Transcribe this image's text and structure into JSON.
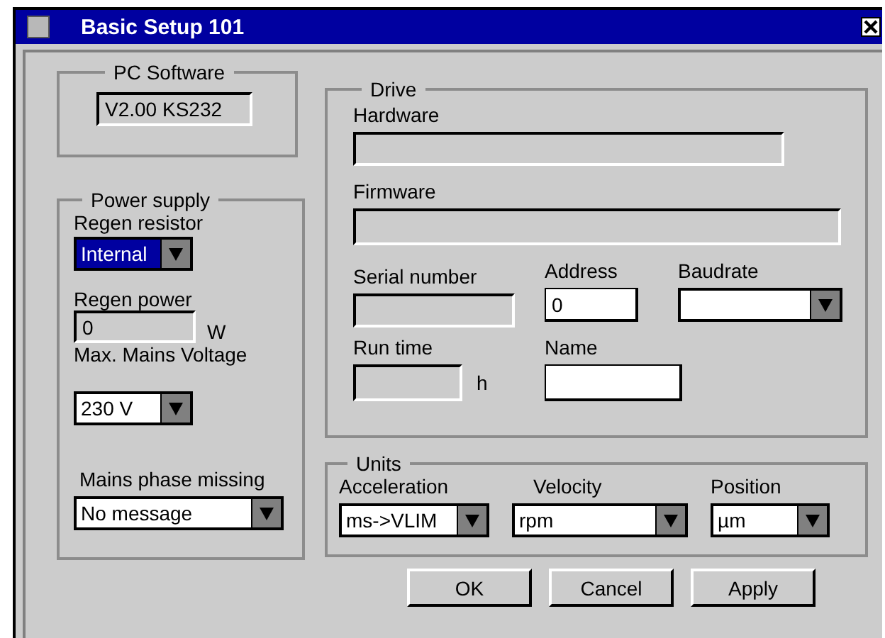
{
  "window": {
    "title": "Basic Setup 101"
  },
  "pc_software": {
    "title": "PC Software",
    "version": {
      "value": "V2.00 KS232",
      "disabled": true
    }
  },
  "power_supply": {
    "title": "Power supply",
    "regen_resistor": {
      "label": "Regen resistor",
      "value": "Internal",
      "focused": true
    },
    "regen_power": {
      "label": "Regen power",
      "value": "0",
      "unit": "W",
      "disabled": true
    },
    "max_mains_voltage": {
      "label": "Max. Mains Voltage",
      "value": "230 V",
      "focused": false
    },
    "mains_phase_missing": {
      "label": "Mains phase missing",
      "value": "No message",
      "focused": false
    }
  },
  "drive": {
    "title": "Drive",
    "hardware": {
      "label": "Hardware",
      "disabled": true
    },
    "firmware": {
      "label": "Firmware",
      "disabled": true
    },
    "serial_number": {
      "label": "Serial number",
      "disabled": true
    },
    "address": {
      "label": "Address",
      "value": "0",
      "disabled": false
    },
    "baudrate": {
      "label": "Baudrate",
      "focused": false
    },
    "run_time": {
      "label": "Run time",
      "unit": "h",
      "disabled": true
    },
    "name": {
      "label": "Name",
      "disabled": false
    }
  },
  "units": {
    "title": "Units",
    "acceleration": {
      "label": "Acceleration",
      "value": "ms->VLIM",
      "focused": false
    },
    "velocity": {
      "label": "Velocity",
      "value": "rpm",
      "focused": false
    },
    "position": {
      "label": "Position",
      "value": "µm",
      "focused": false
    }
  },
  "buttons": [
    "OK",
    "Cancel",
    "Apply"
  ]
}
